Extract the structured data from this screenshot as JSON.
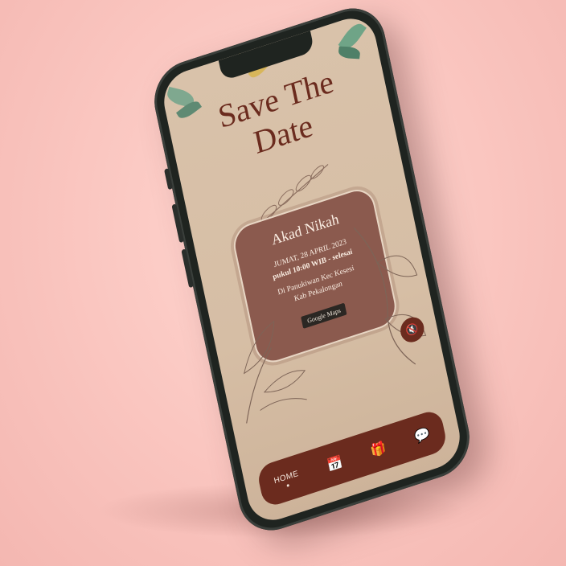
{
  "invitation": {
    "title_line1": "Save The",
    "title_line2": "Date",
    "event_title": "Akad Nikah",
    "event_date": "JUMAT, 28 APRIL 2023",
    "event_time": "pukul 10:00 WIB - selesai",
    "event_place_line1": "Di Panukiwan Kec Kesesi",
    "event_place_line2": "Kab Pekalongan",
    "maps_button": "Google Maps"
  },
  "controls": {
    "mute_icon": "speaker-mute-icon",
    "mute_glyph": "🔇"
  },
  "bottom_nav": {
    "home_label": "HOME",
    "items": [
      {
        "icon": "calendar-icon",
        "glyph": "📅"
      },
      {
        "icon": "gift-icon",
        "glyph": "🎁"
      },
      {
        "icon": "chat-quote-icon",
        "glyph": "💬"
      }
    ]
  },
  "colors": {
    "background": "#f9c3bd",
    "screen": "#d6bea5",
    "accent": "#6b2b1e",
    "card": "#8b5a4e"
  }
}
